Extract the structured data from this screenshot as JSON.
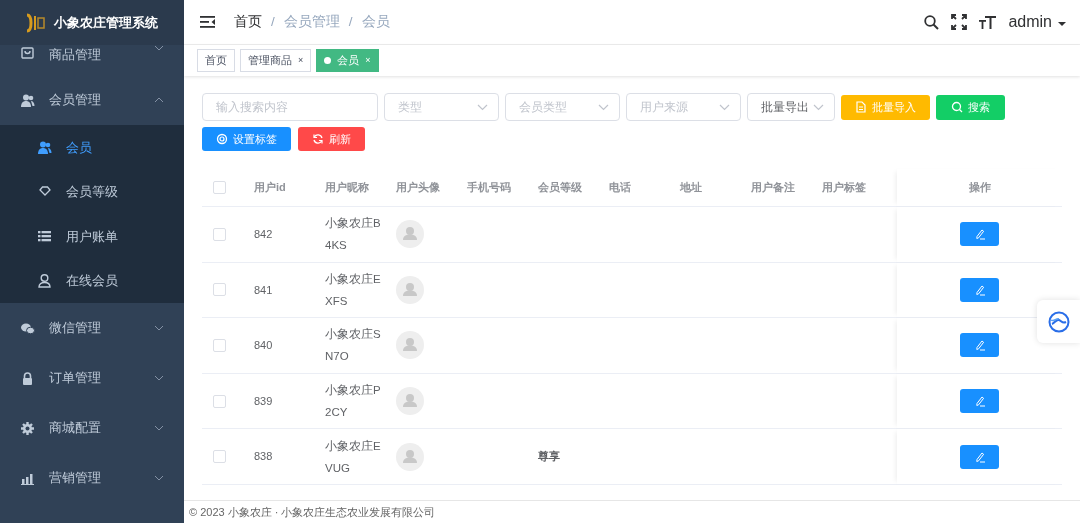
{
  "sidebar": {
    "logo": "小象农庄管理系统",
    "items": [
      {
        "label": "商品管理",
        "expanded": false
      },
      {
        "label": "会员管理",
        "expanded": true,
        "children": [
          {
            "label": "会员",
            "selected": true
          },
          {
            "label": "会员等级",
            "selected": false
          },
          {
            "label": "用户账单",
            "selected": false
          },
          {
            "label": "在线会员",
            "selected": false
          }
        ]
      },
      {
        "label": "微信管理",
        "expanded": false
      },
      {
        "label": "订单管理",
        "expanded": false
      },
      {
        "label": "商城配置",
        "expanded": false
      },
      {
        "label": "营销管理",
        "expanded": false
      }
    ]
  },
  "breadcrumb": [
    "首页",
    "会员管理",
    "会员"
  ],
  "breadcrumb_separator": "/",
  "user": "admin",
  "tabs": [
    {
      "label": "首页",
      "selected": false
    },
    {
      "label": "管理商品",
      "close": "×",
      "selected": false
    },
    {
      "label": "会员",
      "close": "×",
      "selected": true
    }
  ],
  "filters": [
    {
      "kind": "text",
      "placeholder": "输入搜索内容"
    },
    {
      "kind": "select",
      "placeholder": "类型"
    },
    {
      "kind": "select",
      "placeholder": "会员类型"
    },
    {
      "kind": "select",
      "placeholder": "用户来源"
    },
    {
      "kind": "select",
      "value": "批量导出"
    }
  ],
  "buttons": [
    {
      "label": "批量导入",
      "kind": "warning"
    },
    {
      "label": "搜索",
      "kind": "success"
    },
    {
      "label": "设置标签",
      "kind": "primary"
    },
    {
      "label": "刷新",
      "kind": "danger"
    }
  ],
  "table": {
    "all_checked": false,
    "columns": [
      "用户id",
      "用户昵称",
      "用户头像",
      "手机号码",
      "会员等级",
      "电话",
      "地址",
      "用户备注",
      "用户标签",
      "操作"
    ],
    "rows": [
      {
        "checked": false,
        "id": "842",
        "nickname": "小象农庄B4KS",
        "level": null
      },
      {
        "checked": false,
        "id": "841",
        "nickname": "小象农庄EXFS",
        "level": null
      },
      {
        "checked": false,
        "id": "840",
        "nickname": "小象农庄SN7O",
        "level": null
      },
      {
        "checked": false,
        "id": "839",
        "nickname": "小象农庄P2CY",
        "level": null
      },
      {
        "checked": false,
        "id": "838",
        "nickname": "小象农庄EVUG",
        "level": "尊享"
      }
    ]
  },
  "footer": "© 2023 小象农庄 · 小象农庄生态农业发展有限公司"
}
